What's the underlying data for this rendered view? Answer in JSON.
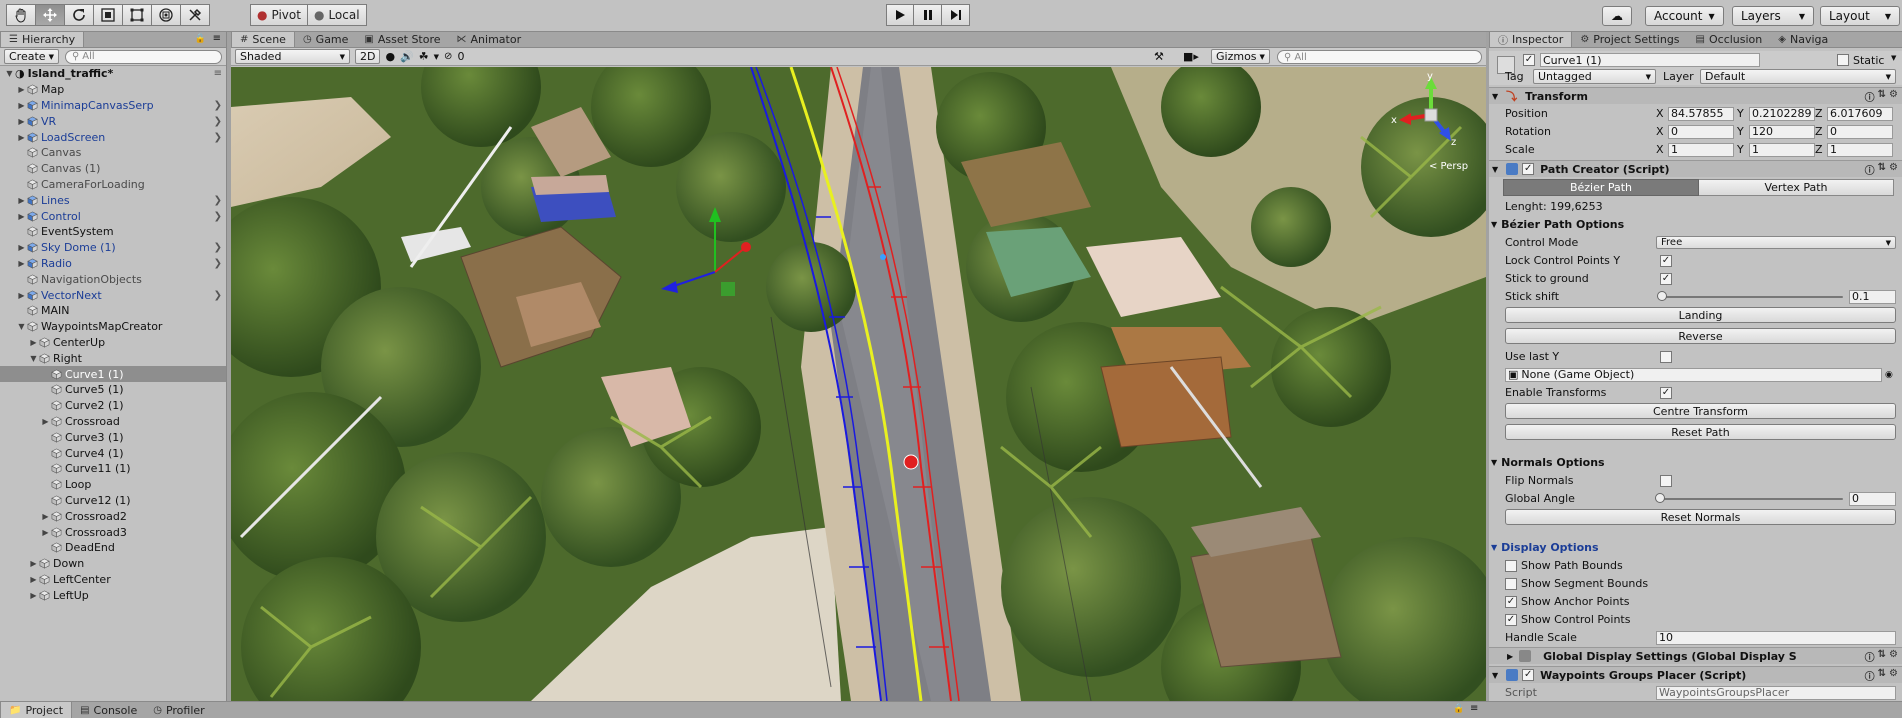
{
  "toolbar": {
    "tools": [
      "hand-tool-icon",
      "move-tool-icon",
      "rotate-tool-icon",
      "scale-tool-icon",
      "rect-tool-icon",
      "transform-tool-icon",
      "custom-tool-icon"
    ],
    "pivot_label": "Pivot",
    "local_label": "Local",
    "account_label": "Account",
    "layers_label": "Layers",
    "layout_label": "Layout"
  },
  "hierarchy": {
    "tab_label": "Hierarchy",
    "create_label": "Create",
    "search_placeholder": "All",
    "scene_name": "Island_traffic*",
    "items": [
      {
        "label": "Map",
        "style": "normal"
      },
      {
        "label": "MinimapCanvasSerp",
        "style": "blue"
      },
      {
        "label": "VR",
        "style": "blue"
      },
      {
        "label": "LoadScreen",
        "style": "blue"
      },
      {
        "label": "Canvas",
        "style": "dim"
      },
      {
        "label": "Canvas (1)",
        "style": "dim"
      },
      {
        "label": "CameraForLoading",
        "style": "dim"
      },
      {
        "label": "Lines",
        "style": "blue"
      },
      {
        "label": "Control",
        "style": "blue"
      },
      {
        "label": "EventSystem",
        "style": "normal"
      },
      {
        "label": "Sky Dome (1)",
        "style": "blue"
      },
      {
        "label": "Radio",
        "style": "blue"
      },
      {
        "label": "NavigationObjects",
        "style": "dim"
      },
      {
        "label": "VectorNext",
        "style": "blue"
      },
      {
        "label": "MAIN",
        "style": "normal"
      },
      {
        "label": "WaypointsMapCreator",
        "style": "normal"
      },
      {
        "label": "CenterUp",
        "style": "normal"
      },
      {
        "label": "Right",
        "style": "normal"
      },
      {
        "label": "Curve1 (1)",
        "style": "selected"
      },
      {
        "label": "Curve5 (1)",
        "style": "normal"
      },
      {
        "label": "Curve2 (1)",
        "style": "normal"
      },
      {
        "label": "Crossroad",
        "style": "normal"
      },
      {
        "label": "Curve3 (1)",
        "style": "normal"
      },
      {
        "label": "Curve4 (1)",
        "style": "normal"
      },
      {
        "label": "Curve11 (1)",
        "style": "normal"
      },
      {
        "label": "Loop",
        "style": "normal"
      },
      {
        "label": "Curve12 (1)",
        "style": "normal"
      },
      {
        "label": "Crossroad2",
        "style": "normal"
      },
      {
        "label": "Crossroad3",
        "style": "normal"
      },
      {
        "label": "DeadEnd",
        "style": "normal"
      },
      {
        "label": "Down",
        "style": "normal"
      },
      {
        "label": "LeftCenter",
        "style": "normal"
      },
      {
        "label": "LeftUp",
        "style": "normal"
      }
    ]
  },
  "scene": {
    "tabs": [
      "Scene",
      "Game",
      "Asset Store",
      "Animator"
    ],
    "shading": "Shaded",
    "mode_2d": "2D",
    "fx_count": "0",
    "gizmos_label": "Gizmos",
    "search_placeholder": "All",
    "persp_label": "< Persp",
    "axis_x": "x",
    "axis_y": "y",
    "axis_z": "z"
  },
  "inspector": {
    "tabs": [
      "Inspector",
      "Project Settings",
      "Occlusion",
      "Naviga"
    ],
    "object_name": "Curve1 (1)",
    "static_label": "Static",
    "tag_label": "Tag",
    "tag_value": "Untagged",
    "layer_label": "Layer",
    "layer_value": "Default",
    "transform": {
      "title": "Transform",
      "position_label": "Position",
      "rotation_label": "Rotation",
      "scale_label": "Scale",
      "x_label": "X",
      "y_label": "Y",
      "z_label": "Z",
      "position": {
        "x": "84.57855",
        "y": "0.2102289",
        "z": "6.017609"
      },
      "rotation": {
        "x": "0",
        "y": "120",
        "z": "0"
      },
      "scale": {
        "x": "1",
        "y": "1",
        "z": "1"
      }
    },
    "path_creator": {
      "title": "Path Creator (Script)",
      "bezier_tab": "Bézier Path",
      "vertex_tab": "Vertex Path",
      "length_text": "Lenght: 199,6253",
      "options_title": "Bézier Path Options",
      "control_mode_label": "Control Mode",
      "control_mode_value": "Free",
      "lock_y_label": "Lock Control Points Y",
      "stick_ground_label": "Stick to ground",
      "stick_shift_label": "Stick shift",
      "stick_shift_value": "0.1",
      "stick_shift_level": 0,
      "landing_button": "Landing",
      "reverse_button": "Reverse",
      "use_last_y_label": "Use last Y",
      "none_object": "None (Game Object)",
      "enable_transforms_label": "Enable Transforms",
      "centre_button": "Centre Transform",
      "reset_path_button": "Reset Path",
      "normals_title": "Normals Options",
      "flip_normals_label": "Flip Normals",
      "global_angle_label": "Global Angle",
      "global_angle_value": "0",
      "global_angle_level": 0,
      "reset_normals_button": "Reset Normals",
      "display_title": "Display Options",
      "show_path_bounds": "Show Path Bounds",
      "show_segment_bounds": "Show Segment Bounds",
      "show_anchor_points": "Show Anchor Points",
      "show_control_points": "Show Control Points",
      "handle_scale_label": "Handle Scale",
      "handle_scale_value": "10",
      "global_display": "Global Display Settings (Global Display S"
    },
    "waypoints": {
      "title": "Waypoints Groups Placer (Script)",
      "script_label": "Script",
      "script_value": "WaypointsGroupsPlacer"
    }
  },
  "bottom_tabs": [
    "Project",
    "Console",
    "Profiler"
  ],
  "colors": {
    "accent": "#1b3d97",
    "path_red": "#e02020",
    "path_blue": "#1a1adf",
    "path_yellow": "#e8f020"
  }
}
